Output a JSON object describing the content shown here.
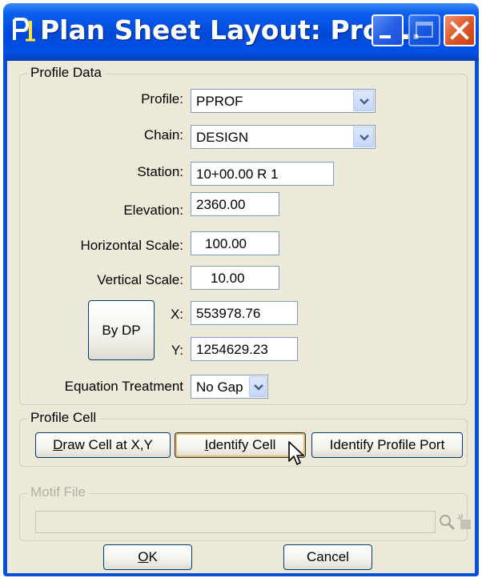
{
  "window": {
    "title": "Plan Sheet Layout: Prof...",
    "accent": "#0a4fd8"
  },
  "titlebar_buttons": {
    "minimize": "minimize-icon",
    "maximize": "maximize-icon",
    "close": "close-icon"
  },
  "profile_data": {
    "legend": "Profile Data",
    "profile_label": "Profile:",
    "profile_value": "PPROF",
    "chain_label": "Chain:",
    "chain_value": "DESIGN",
    "station_label": "Station:",
    "station_value": "10+00.00 R 1",
    "elevation_label": "Elevation:",
    "elevation_value": "2360.00",
    "hscale_label": "Horizontal Scale:",
    "hscale_value": "100.00",
    "vscale_label": "Vertical Scale:",
    "vscale_value": "10.00",
    "bydp_label": "By DP",
    "x_label": "X:",
    "x_value": "553978.76",
    "y_label": "Y:",
    "y_value": "1254629.23",
    "equation_label": "Equation Treatment",
    "equation_value": "No Gap"
  },
  "profile_cell": {
    "legend": "Profile Cell",
    "draw_cell_prefix": "D",
    "draw_cell_rest": "raw Cell at X,Y",
    "identify_cell_prefix": "I",
    "identify_cell_rest": "dentify Cell",
    "identify_port": "Identify Profile Port"
  },
  "motif_file": {
    "legend": "Motif File",
    "value": ""
  },
  "footer": {
    "ok_prefix": "O",
    "ok_rest": "K",
    "cancel": "Cancel"
  }
}
